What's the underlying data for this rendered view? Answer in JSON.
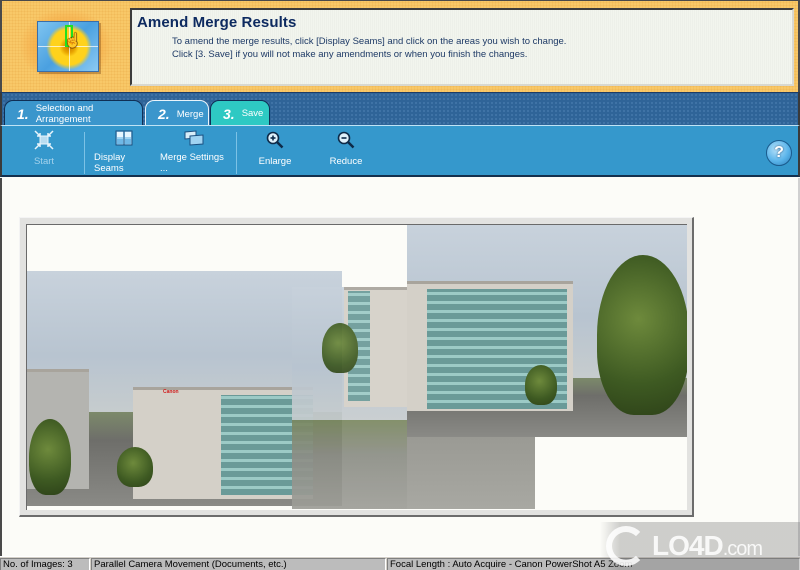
{
  "header": {
    "title": "Amend Merge Results",
    "instructions": [
      "To amend the merge results, click [Display Seams] and click on the areas you wish to change.",
      "Click [3. Save] if you will not make any amendments or when you finish the changes."
    ],
    "logo_icon": "flower-stitch-icon"
  },
  "tabs": [
    {
      "number": "1.",
      "label": "Selection and Arrangement",
      "active": false
    },
    {
      "number": "2.",
      "label": "Merge",
      "active": true
    },
    {
      "number": "3.",
      "label": "Save",
      "active": false
    }
  ],
  "toolbar": {
    "buttons": [
      {
        "label": "Start",
        "icon": "start-arrows-icon",
        "enabled": false
      },
      {
        "label": "Display Seams",
        "icon": "display-seams-icon",
        "enabled": true
      },
      {
        "label": "Merge Settings ...",
        "icon": "merge-settings-icon",
        "enabled": true
      },
      {
        "label": "Enlarge",
        "icon": "zoom-in-icon",
        "enabled": true
      },
      {
        "label": "Reduce",
        "icon": "zoom-out-icon",
        "enabled": true
      }
    ],
    "help_label": "?"
  },
  "canvas": {
    "description": "Merged panorama preview of Canon office buildings",
    "sign_text": "Canon"
  },
  "statusbar": {
    "image_count": "No. of Images: 3",
    "mode": "Parallel Camera Movement (Documents, etc.)",
    "focal_length": "Focal Length : Auto Acquire - Canon PowerShot A5 Zoom"
  },
  "watermark": {
    "brand": "LO4D",
    "suffix": ".com"
  },
  "colors": {
    "header_bg": "#f8c868",
    "title_text": "#0d2a60",
    "tabstrip_bg": "#2f6498",
    "tab_bg": "#3b96cc",
    "save_tab_bg": "#2ec9c3",
    "toolbar_bg": "#3598cc",
    "canvas_bg": "#fcfcf8",
    "statusbar_bg": "#bcbcbc"
  }
}
